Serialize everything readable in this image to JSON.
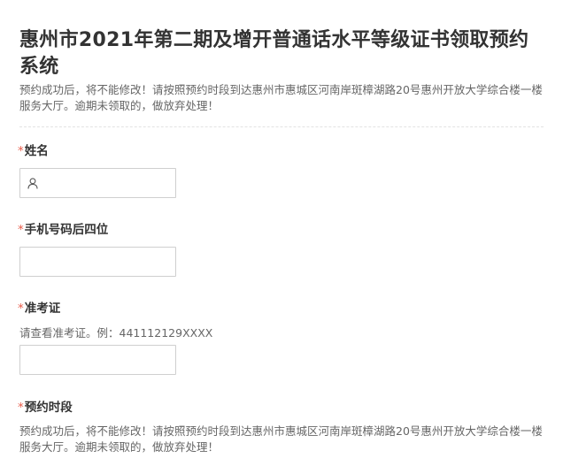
{
  "page": {
    "title": "惠州市2021年第二期及增开普通话水平等级证书领取预约系统",
    "notice": "预约成功后，将不能修改！请按照预约时段到达惠州市惠城区河南岸斑樟湖路20号惠州开放大学综合楼一楼服务大厅。逾期未领取的，做放弃处理！"
  },
  "fields": {
    "required_mark": "*",
    "name": {
      "label": "姓名",
      "value": "",
      "icon": "user-icon"
    },
    "phone_last4": {
      "label": "手机号码后四位",
      "value": ""
    },
    "ticket": {
      "label": "准考证",
      "hint": "请查看准考证。例：441112129XXXX",
      "value": ""
    },
    "slot": {
      "label": "预约时段",
      "notice": "预约成功后，将不能修改！请按照预约时段到达惠州市惠城区河南岸斑樟湖路20号惠州开放大学综合楼一楼服务大厅。逾期未领取的，做放弃处理！"
    }
  }
}
